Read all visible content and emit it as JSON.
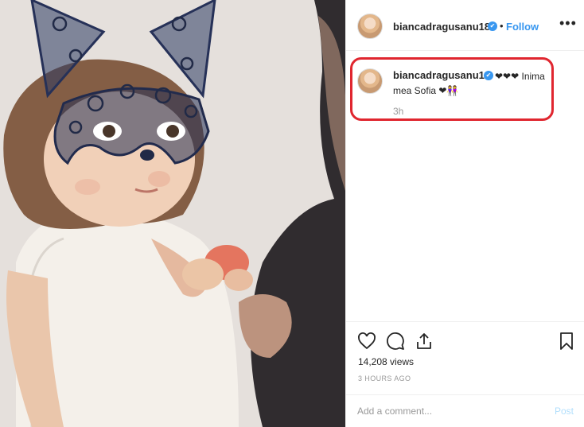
{
  "post": {
    "username": "biancadragusanu18",
    "follow_label": "Follow",
    "separator": "•",
    "more_label": "•••",
    "verified_glyph": "✔"
  },
  "caption": {
    "username": "biancadragusanu18",
    "text_line1": "❤❤❤ Inima",
    "text_line2": "mea Sofia ❤👭",
    "age": "3h"
  },
  "stats": {
    "views": "14,208 views",
    "time_ago": "3 HOURS AGO"
  },
  "comment": {
    "placeholder": "Add a comment...",
    "post_label": "Post"
  },
  "icons": [
    "heart-icon",
    "comment-icon",
    "share-icon",
    "bookmark-icon",
    "verified-icon",
    "more-icon"
  ],
  "colors": {
    "accent": "#3897f0",
    "highlight": "#e0262f",
    "muted": "#999999",
    "post_disabled": "#b2dffc"
  }
}
